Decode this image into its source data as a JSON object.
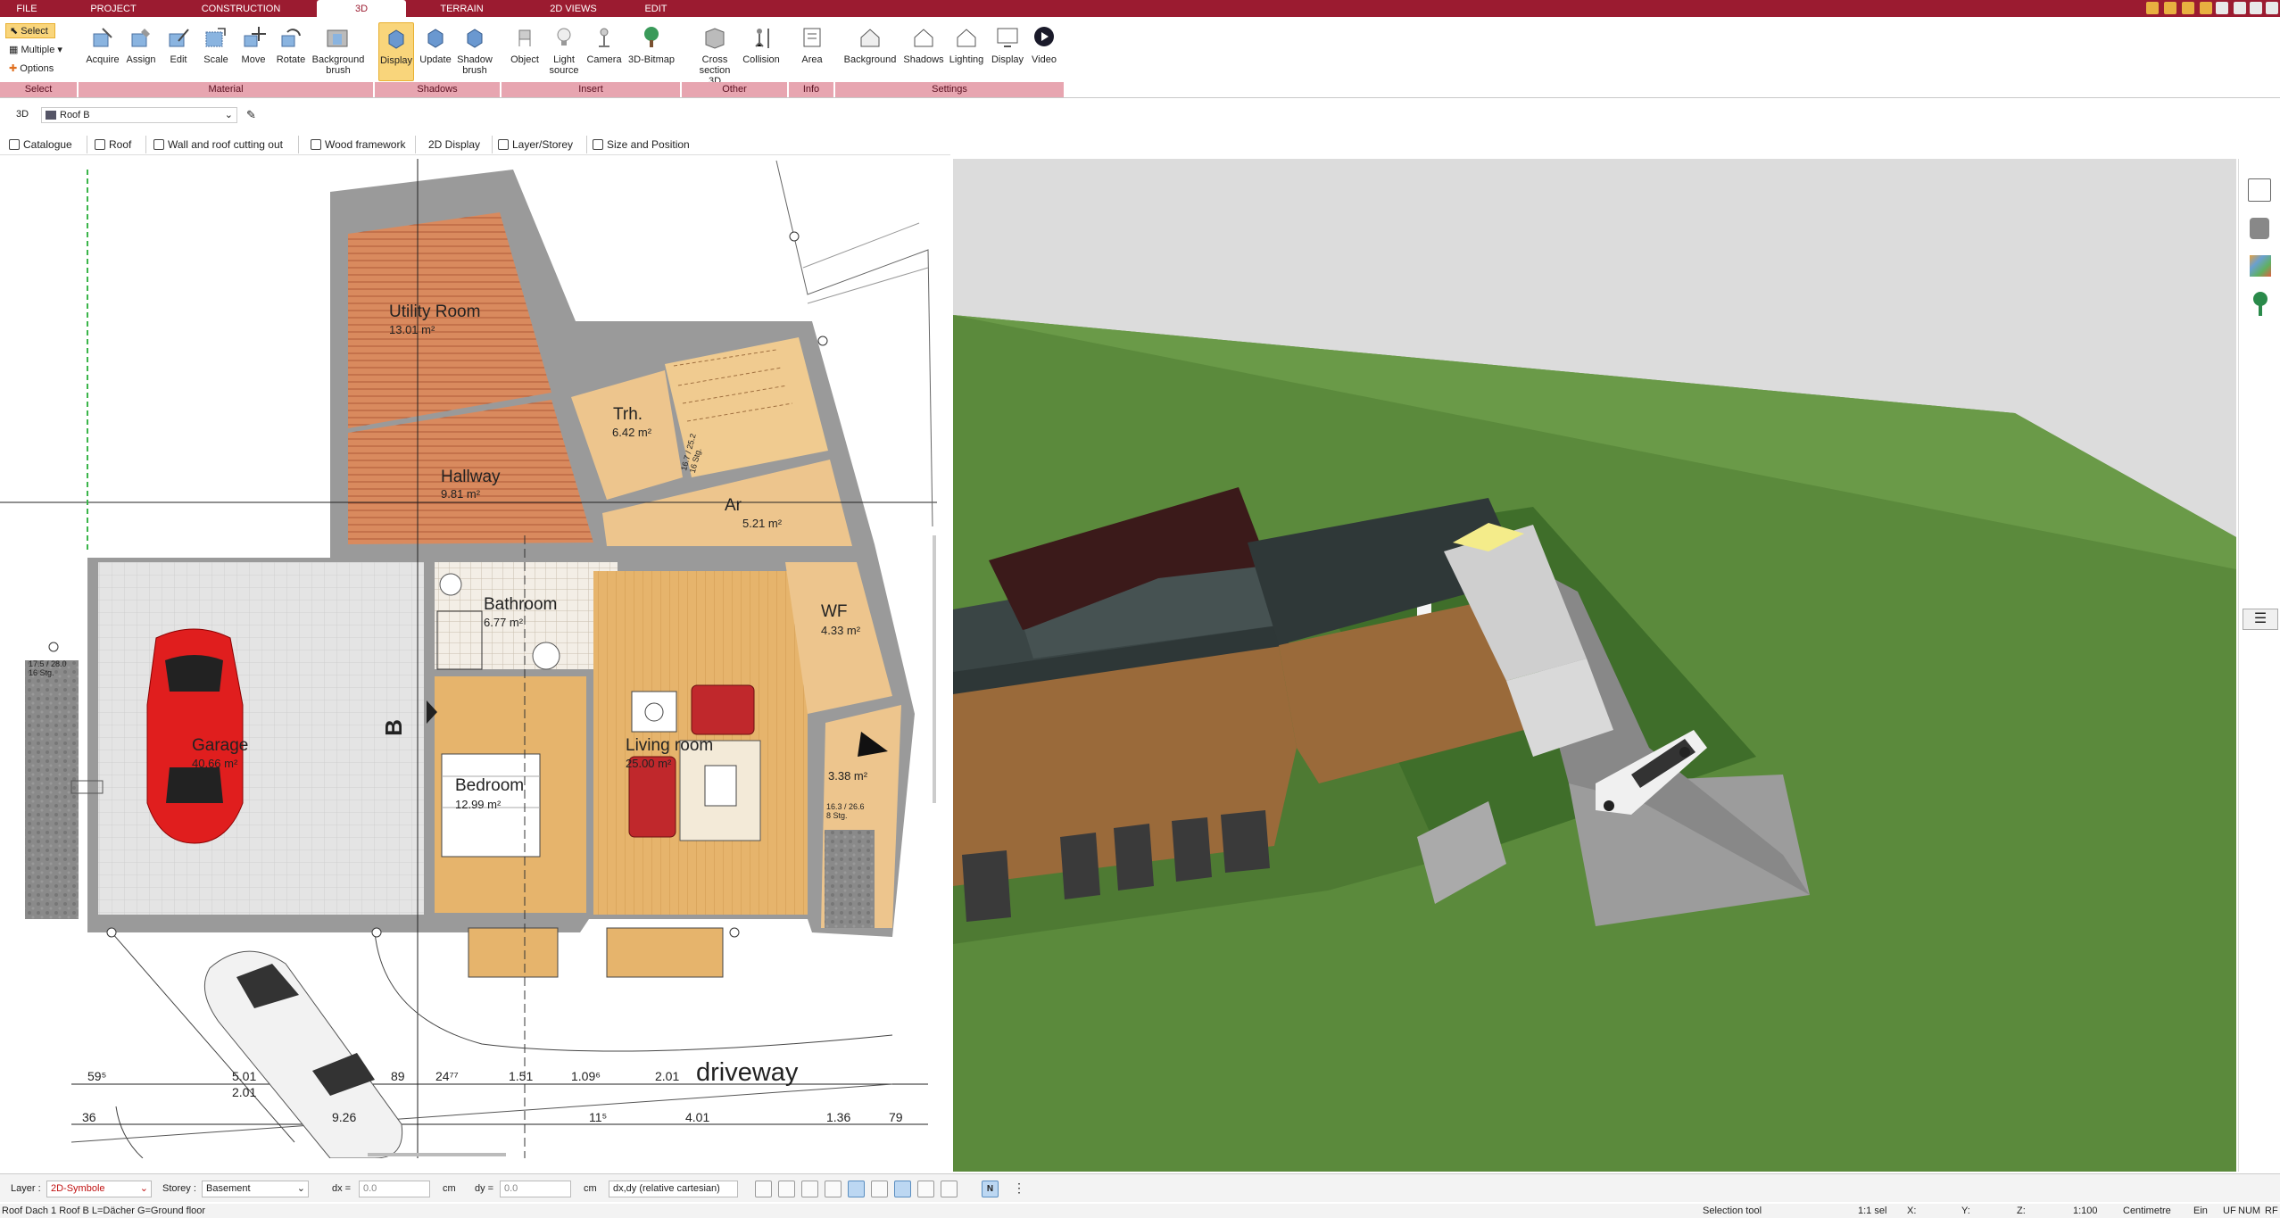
{
  "menu": {
    "tabs": [
      "FILE",
      "PROJECT",
      "CONSTRUCTION",
      "3D",
      "TERRAIN",
      "2D VIEWS",
      "EDIT"
    ],
    "active": "3D"
  },
  "ribbon": {
    "select_label": "Select",
    "multiple_label": "Multiple",
    "options_label": "Options",
    "buttons": {
      "acquire": "Acquire",
      "assign": "Assign",
      "edit": "Edit",
      "scale": "Scale",
      "move": "Move",
      "rotate": "Rotate",
      "background_brush": "Background brush",
      "display": "Display",
      "update": "Update",
      "shadow_brush": "Shadow brush",
      "object": "Object",
      "light_source": "Light source",
      "camera": "Camera",
      "bitmap3d": "3D-Bitmap",
      "cross_section": "Cross section 3D",
      "collision": "Collision",
      "area": "Area",
      "background": "Background",
      "shadows": "Shadows",
      "lighting": "Lighting",
      "display2": "Display",
      "video": "Video"
    },
    "groups": {
      "select": "Select",
      "material": "Material",
      "shadows": "Shadows",
      "insert": "Insert",
      "other": "Other",
      "info": "Info",
      "settings": "Settings"
    }
  },
  "pathbar": {
    "mode": "3D",
    "object": "Roof B"
  },
  "toolbar2": {
    "catalogue": "Catalogue",
    "roof": "Roof",
    "wall_roof": "Wall and roof cutting out",
    "wood": "Wood framework",
    "display2d": "2D  Display",
    "layer": "Layer/Storey",
    "size": "Size and Position"
  },
  "plan": {
    "rooms": [
      {
        "name": "Utility Room",
        "area": "13.01 m²"
      },
      {
        "name": "Trh.",
        "area": "6.42 m²"
      },
      {
        "name": "Hallway",
        "area": "9.81 m²"
      },
      {
        "name": "Ar",
        "area": "5.21 m²"
      },
      {
        "name": "Bathroom",
        "area": "6.77 m²"
      },
      {
        "name": "WF",
        "area": "4.33 m²"
      },
      {
        "name": "Garage",
        "area": "40.66 m²"
      },
      {
        "name": "Bedroom",
        "area": "12.99 m²"
      },
      {
        "name": "Living room",
        "area": "25.00 m²"
      },
      {
        "name": "",
        "area": "3.38 m²"
      }
    ],
    "section_mark": "B",
    "stair_note": "16.3 / 26.6\n8 Stg.",
    "stair_note2": "17.5 / 28.0\n16 Stg.",
    "stair_note3": "16.7 / 25.2\n16 Stg.",
    "driveway": "driveway",
    "dims": [
      "59⁵",
      "5.01",
      "2.01",
      "89",
      "24⁷⁷",
      "1.51",
      "1.09⁶",
      "2.01",
      "36",
      "9.26",
      "11⁵",
      "4.01",
      "1.36",
      "79"
    ]
  },
  "status": {
    "layer_label": "Layer :",
    "layer_value": "2D-Symbole",
    "storey_label": "Storey :",
    "storey_value": "Basement",
    "dx_label": "dx =",
    "dx_value": "0.0",
    "dy_label": "dy =",
    "dy_value": "0.0",
    "unit": "cm",
    "coord_mode": "dx,dy (relative cartesian)"
  },
  "infobar": {
    "left": "Roof Dach 1 Roof B L=Dächer G=Ground floor",
    "tool": "Selection tool",
    "sel": "1:1 sel",
    "x": "X:",
    "y": "Y:",
    "z": "Z:",
    "scale": "1:100",
    "unit": "Centimetre",
    "ein": "Ein",
    "uf": "UF",
    "num": "NUM",
    "rf": "RF"
  },
  "colors": {
    "brand": "#9b1b30",
    "group_bar": "#e7a5b0",
    "grass": "#5b8a3c",
    "sky": "#dcdcdc"
  }
}
